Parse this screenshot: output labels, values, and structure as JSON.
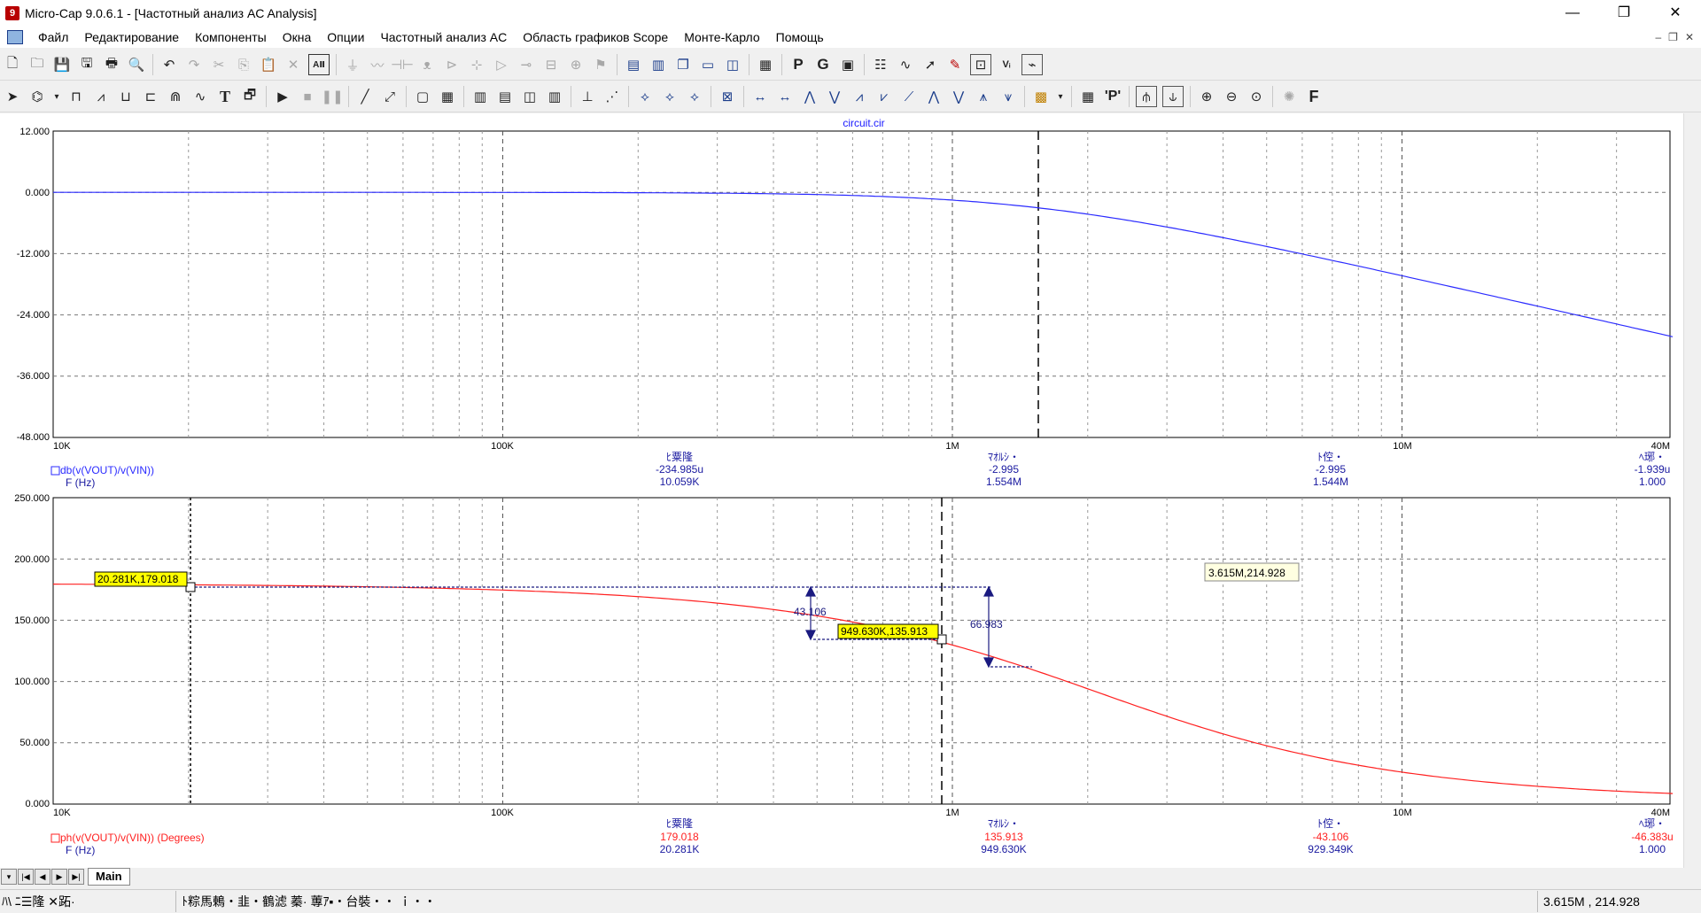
{
  "window": {
    "title": "Micro-Cap 9.0.6.1 - [Частотный анализ AC Analysis]",
    "controls": [
      "—",
      "❐",
      "✕"
    ],
    "mdi_controls": [
      "–",
      "❐",
      "✕"
    ]
  },
  "menu": {
    "items": [
      "Файл",
      "Редактирование",
      "Компоненты",
      "Окна",
      "Опции",
      "Частотный анализ AC",
      "Область графиков Scope",
      "Монте-Карло",
      "Помощь"
    ]
  },
  "toolbar_icons": {
    "row1": [
      "new-file",
      "open-file",
      "save-file",
      "save-all",
      "print",
      "print-preview",
      "undo",
      "redo",
      "cut",
      "copy",
      "paste",
      "delete",
      "text-all",
      "ground",
      "resistor",
      "capacitor",
      "inductor",
      "diode",
      "transistor",
      "opamp",
      "switch",
      "battery",
      "source",
      "tile-horizontal",
      "tile-vertical",
      "cascade",
      "window-a",
      "window-b",
      "calculator",
      "probe-P",
      "probe-G",
      "component-editor",
      "properties",
      "spectrum",
      "pointer-arrow",
      "pen",
      "plot-props",
      "xy-scale",
      "wave-view"
    ],
    "row1_text": {
      "p": "P",
      "g": "G"
    },
    "row2": [
      "select-arrow",
      "component-select",
      "dropdown",
      "wire-mode",
      "diagonal-wire",
      "bus",
      "port",
      "grid-text",
      "text-T",
      "info",
      "run",
      "stop",
      "pause",
      "line",
      "arrow-line",
      "rectangle",
      "grid",
      "table1",
      "table2",
      "table3",
      "table4",
      "marker-line",
      "markers",
      "peak",
      "valley",
      "slope",
      "high",
      "low",
      "inflection",
      "crossover",
      "zoom-fit",
      "zoom-in",
      "zoom-out",
      "zoom-window",
      "graphs",
      "data-points",
      "tokens",
      "font-F"
    ],
    "row2_text": {
      "t": "T",
      "f": "F",
      "p": "'P'"
    }
  },
  "plot1": {
    "header": "circuit.cir",
    "y_ticks": [
      "12.000",
      "0.000",
      "-12.000",
      "-24.000",
      "-36.000",
      "-48.000"
    ],
    "x_ticks": [
      "10K",
      "100K",
      "1M",
      "10M",
      "40M"
    ],
    "trace_color": "#2b2bff",
    "trace_label": "db(v(VOUT)/v(VIN))",
    "x_var": "F (Hz)",
    "cols": [
      {
        "head": "ﾋ粟隆",
        "y": "-234.985u",
        "x": "10.059K"
      },
      {
        "head": "ﾏｵﾙｼ・",
        "y": "-2.995",
        "x": "1.554M"
      },
      {
        "head": "ﾄ倥・",
        "y": "-2.995",
        "x": "1.544M"
      },
      {
        "head": "ﾍ琊・",
        "y": "-1.939u",
        "x": "1.000"
      }
    ]
  },
  "plot2": {
    "y_ticks": [
      "250.000",
      "200.000",
      "150.000",
      "100.000",
      "50.000",
      "0.000"
    ],
    "x_ticks": [
      "10K",
      "100K",
      "1M",
      "10M",
      "40M"
    ],
    "trace_color": "#ff2020",
    "trace_label": "ph(v(VOUT)/v(VIN)) (Degrees)",
    "x_var": "F (Hz)",
    "cols": [
      {
        "head": "ﾋ粟隆",
        "y": "179.018",
        "x": "20.281K"
      },
      {
        "head": "ﾏｵﾙｼ・",
        "y": "135.913",
        "x": "949.630K"
      },
      {
        "head": "ﾄ倥・",
        "y": "-43.106",
        "x": "929.349K"
      },
      {
        "head": "ﾍ琊・",
        "y": "-46.383u",
        "x": "1.000"
      }
    ],
    "tags": {
      "left_cursor": "20.281K,179.018",
      "right_cursor": "949.630K,135.913",
      "hover": "3.615M,214.928"
    },
    "delta_labels": {
      "d1": "43.106",
      "d2": "66.983"
    }
  },
  "tabs": {
    "main": "Main"
  },
  "status": {
    "s1": "ﾊ\\ ﾆ☰隆 ✕跖·",
    "s2": "ﾄ粽馬鶇・韭・鶴滤 蓁· 蓴ｱ▪・台裝・・ ｉ・・",
    "s3": "3.615M , 214.928"
  }
}
